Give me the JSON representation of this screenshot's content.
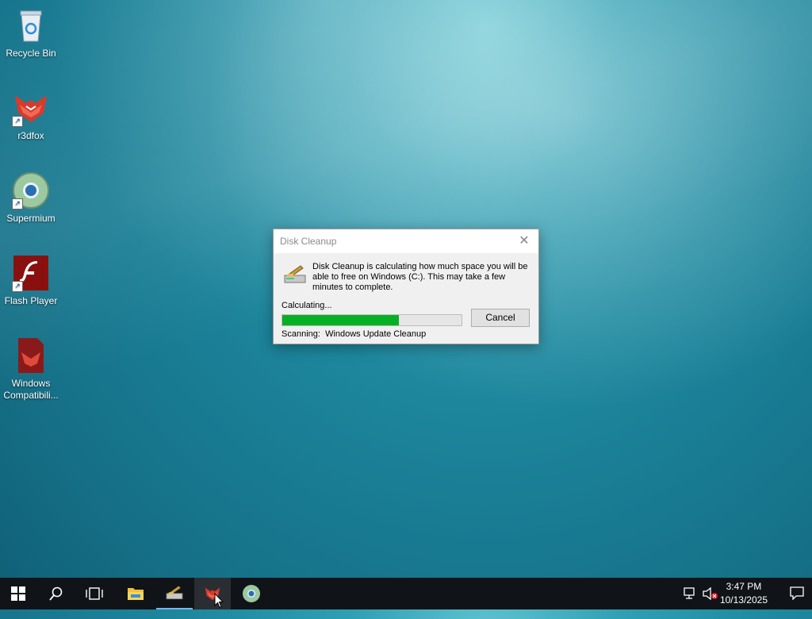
{
  "desktop": {
    "icons": [
      {
        "label": "Recycle Bin",
        "icon": "recycle-bin-icon"
      },
      {
        "label": "r3dfox",
        "icon": "r3dfox-icon"
      },
      {
        "label": "Supermium",
        "icon": "supermium-icon"
      },
      {
        "label": "Flash Player",
        "icon": "flash-player-icon"
      },
      {
        "label": "Windows Compatibili...",
        "icon": "windows-compatibility-icon"
      }
    ]
  },
  "dialog": {
    "title": "Disk Cleanup",
    "message": "Disk Cleanup is calculating how much space you will be able to free on Windows (C:). This may take a few minutes to complete.",
    "status": "Calculating...",
    "progress_percent": 65,
    "cancel_label": "Cancel",
    "scanning_label": "Scanning:",
    "scanning_item": "Windows Update Cleanup"
  },
  "taskbar": {
    "buttons": [
      "start-icon",
      "search-icon",
      "task-view-icon",
      "file-explorer-icon",
      "disk-cleanup-icon",
      "r3dfox-icon",
      "supermium-icon"
    ],
    "time": "3:47 PM",
    "date": "10/13/2025",
    "colors": {
      "progress": "#06b025",
      "taskbar": "#101418",
      "active_indicator": "#7ab6ec"
    }
  }
}
